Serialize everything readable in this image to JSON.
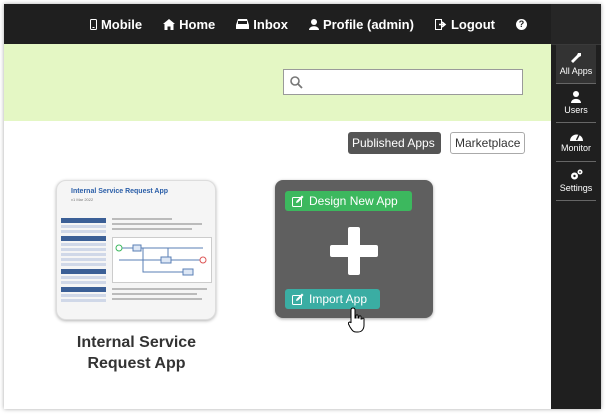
{
  "nav": {
    "mobile": "Mobile",
    "home": "Home",
    "inbox": "Inbox",
    "profile": "Profile (admin)",
    "logout": "Logout",
    "help": "?"
  },
  "search": {
    "value": "",
    "placeholder": ""
  },
  "sidebar": {
    "items": [
      {
        "label": "All Apps",
        "icon": "wrench-icon"
      },
      {
        "label": "Users",
        "icon": "user-icon"
      },
      {
        "label": "Monitor",
        "icon": "dashboard-icon"
      },
      {
        "label": "Settings",
        "icon": "gears-icon"
      }
    ]
  },
  "tabs": {
    "published": "Published Apps",
    "marketplace": "Marketplace"
  },
  "app": {
    "name_line1": "Internal Service",
    "name_line2": "Request App",
    "thumb_title": "Internal Service Request App",
    "thumb_sub": "v1 Mar 2022"
  },
  "design": {
    "design_label": "Design New App",
    "import_label": "Import App"
  },
  "colors": {
    "topbar": "#1f1f1f",
    "band": "#e4f7c4",
    "green": "#3cb85e",
    "teal": "#3aada3",
    "card": "#5f5f5f"
  }
}
